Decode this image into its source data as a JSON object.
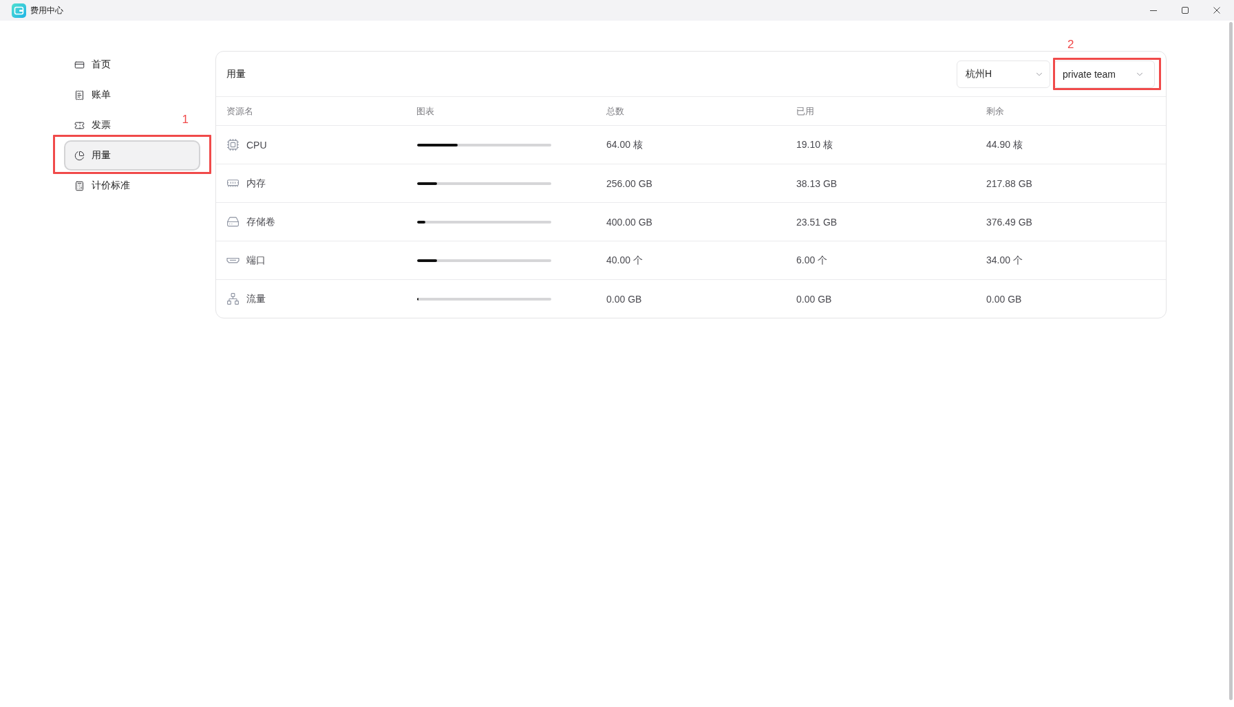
{
  "window": {
    "title": "费用中心"
  },
  "sidebar": {
    "items": [
      {
        "label": "首页",
        "selected": false
      },
      {
        "label": "账单",
        "selected": false
      },
      {
        "label": "发票",
        "selected": false
      },
      {
        "label": "用量",
        "selected": true,
        "callout": "1"
      },
      {
        "label": "计价标准",
        "selected": false
      }
    ]
  },
  "usage": {
    "title": "用量",
    "filters": [
      {
        "value": "杭州H"
      },
      {
        "value": "private team",
        "callout": "2"
      }
    ],
    "table": {
      "columns": [
        "资源名",
        "图表",
        "总数",
        "已用",
        "剩余"
      ],
      "rows": [
        {
          "name": "CPU",
          "level": 0.3,
          "total": "64.00 核",
          "used": "19.10 核",
          "remaining": "44.90 核"
        },
        {
          "name": "内存",
          "level": 0.15,
          "total": "256.00 GB",
          "used": "38.13 GB",
          "remaining": "217.88 GB"
        },
        {
          "name": "存储卷",
          "level": 0.06,
          "total": "400.00 GB",
          "used": "23.51 GB",
          "remaining": "376.49 GB"
        },
        {
          "name": "端口",
          "level": 0.15,
          "total": "40.00 个",
          "used": "6.00 个",
          "remaining": "34.00 个"
        },
        {
          "name": "流量",
          "level": 0,
          "total": "0.00 GB",
          "used": "0.00 GB",
          "remaining": "0.00 GB"
        }
      ]
    }
  }
}
